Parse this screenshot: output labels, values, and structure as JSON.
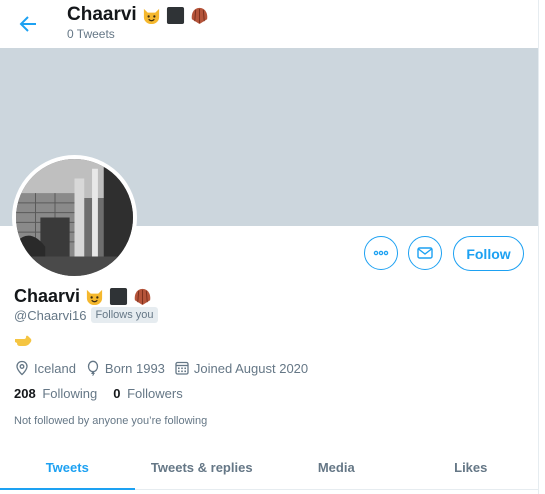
{
  "header": {
    "name": "Chaarvi",
    "tweet_count": "0 Tweets"
  },
  "profile": {
    "name": "Chaarvi",
    "emojis": [
      "cat-emoji",
      "black-square-emoji",
      "shell-emoji"
    ],
    "handle": "@Chaarvi16",
    "follows_you": "Follows you",
    "bio_emoji": "pointing-hand-emoji",
    "location": "Iceland",
    "born": "Born 1993",
    "joined": "Joined August 2020",
    "following_count": "208",
    "following_label": "Following",
    "followers_count": "0",
    "followers_label": "Followers",
    "followed_note": "Not followed by anyone you’re following"
  },
  "actions": {
    "follow_label": "Follow"
  },
  "tabs": [
    {
      "label": "Tweets",
      "active": true
    },
    {
      "label": "Tweets & replies",
      "active": false
    },
    {
      "label": "Media",
      "active": false
    },
    {
      "label": "Likes",
      "active": false
    }
  ],
  "colors": {
    "accent": "#1da1f2",
    "banner": "#ccd6dd",
    "secondary_text": "#657786"
  }
}
